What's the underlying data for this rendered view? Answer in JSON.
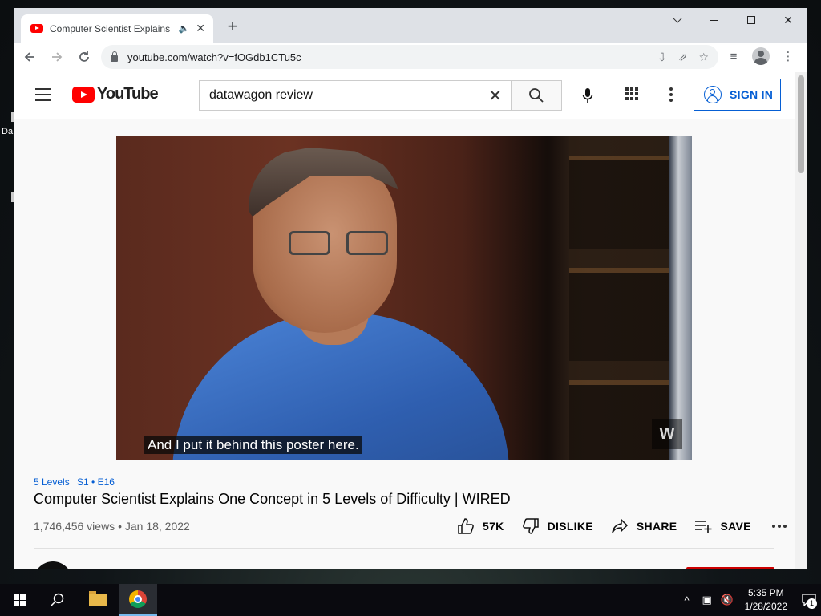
{
  "desktop": {
    "label": "Da"
  },
  "browser": {
    "tab_title": "Computer Scientist Explains One Concept in 5 Levels of Difficulty | WIRED",
    "tab_title_visible": "Computer Scientist Explains",
    "new_tab": "+",
    "url": "youtube.com/watch?v=fOGdb1CTu5c"
  },
  "youtube": {
    "logo_text": "YouTube",
    "search_value": "datawagon review",
    "signin_label": "SIGN IN"
  },
  "video": {
    "subtitle": "And I put it behind this poster here.",
    "watermark": "W"
  },
  "meta": {
    "series": "5 Levels",
    "episode": "S1 • E16",
    "title": "Computer Scientist Explains One Concept in 5 Levels of Difficulty | WIRED",
    "views_date": "1,746,456 views • Jan 18, 2022",
    "likes": "57K",
    "dislike_label": "DISLIKE",
    "share_label": "SHARE",
    "save_label": "SAVE"
  },
  "taskbar": {
    "time": "5:35 PM",
    "date": "1/28/2022",
    "notification_count": "1"
  }
}
